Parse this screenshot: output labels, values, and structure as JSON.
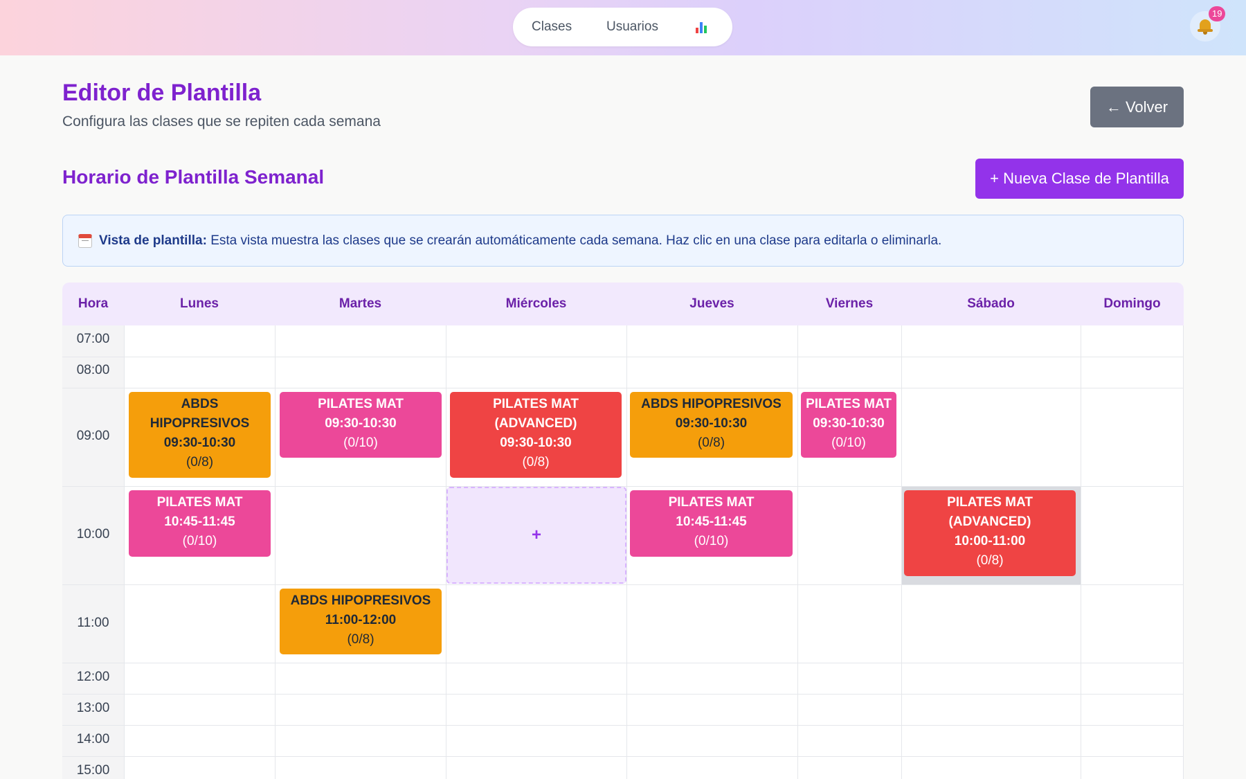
{
  "nav": {
    "clases": "Clases",
    "usuarios": "Usuarios",
    "stats_icon": "bar-chart-icon",
    "notifications_icon": "bell-icon",
    "notification_count": "19"
  },
  "header": {
    "title": "Editor de Plantilla",
    "subtitle": "Configura las clases que se repiten cada semana",
    "back_label": "← Volver"
  },
  "section": {
    "title": "Horario de Plantilla Semanal",
    "new_class_label": "+ Nueva Clase de Plantilla"
  },
  "info": {
    "icon": "calendar-icon",
    "label": "Vista de plantilla:",
    "text": "Esta vista muestra las clases que se crearán automáticamente cada semana. Haz clic en una clase para editarla o eliminarla."
  },
  "schedule": {
    "time_header": "Hora",
    "days": [
      "Lunes",
      "Martes",
      "Miércoles",
      "Jueves",
      "Viernes",
      "Sábado",
      "Domingo"
    ],
    "hours": [
      "07:00",
      "08:00",
      "09:00",
      "10:00",
      "11:00",
      "12:00",
      "13:00",
      "14:00",
      "15:00"
    ],
    "add_symbol": "+",
    "classes": [
      {
        "day": "Lunes",
        "slot": "09:00",
        "name": "ABDS HIPOPRESIVOS",
        "time": "09:30-10:30",
        "capacity": "(0/8)"
      },
      {
        "day": "Martes",
        "slot": "09:00",
        "name": "PILATES MAT",
        "time": "09:30-10:30",
        "capacity": "(0/10)"
      },
      {
        "day": "Miércoles",
        "slot": "09:00",
        "name": "PILATES MAT (ADVANCED)",
        "time": "09:30-10:30",
        "capacity": "(0/8)"
      },
      {
        "day": "Jueves",
        "slot": "09:00",
        "name": "ABDS HIPOPRESIVOS",
        "time": "09:30-10:30",
        "capacity": "(0/8)"
      },
      {
        "day": "Viernes",
        "slot": "09:00",
        "name": "PILATES MAT",
        "time": "09:30-10:30",
        "capacity": "(0/10)"
      },
      {
        "day": "Lunes",
        "slot": "10:00",
        "name": "PILATES MAT",
        "time": "10:45-11:45",
        "capacity": "(0/10)"
      },
      {
        "day": "Jueves",
        "slot": "10:00",
        "name": "PILATES MAT",
        "time": "10:45-11:45",
        "capacity": "(0/10)"
      },
      {
        "day": "Sábado",
        "slot": "10:00",
        "name": "PILATES MAT (ADVANCED)",
        "time": "10:00-11:00",
        "capacity": "(0/8)"
      },
      {
        "day": "Martes",
        "slot": "11:00",
        "name": "ABDS HIPOPRESIVOS",
        "time": "11:00-12:00",
        "capacity": "(0/8)"
      }
    ]
  },
  "colors": {
    "primary": "#9333ea",
    "title": "#7e22ce",
    "hipopresivos": "#f59e0b",
    "pilates_mat": "#ec4899",
    "pilates_advanced": "#ef4444",
    "back_button": "#6b7280"
  }
}
